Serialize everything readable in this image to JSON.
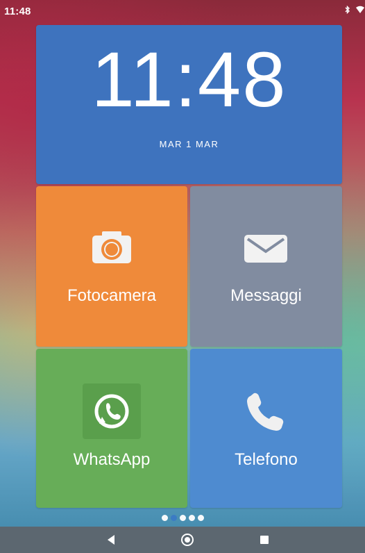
{
  "status_bar": {
    "time": "11:48",
    "icons": [
      "bluetooth-icon",
      "wifi-icon"
    ]
  },
  "clock_widget": {
    "time": "11:48",
    "date": "MAR 1 MAR"
  },
  "tiles": [
    {
      "label": "Fotocamera",
      "icon": "camera-icon",
      "color": "#ef8a3a"
    },
    {
      "label": "Messaggi",
      "icon": "mail-icon",
      "color": "#818ca0"
    },
    {
      "label": "WhatsApp",
      "icon": "whatsapp-icon",
      "color": "#67ad58"
    },
    {
      "label": "Telefono",
      "icon": "phone-icon",
      "color": "#4e8bd0"
    }
  ],
  "pager": {
    "total": 5,
    "active": 2
  },
  "navbar": {
    "buttons": [
      "back-icon",
      "home-icon",
      "recents-icon"
    ]
  }
}
